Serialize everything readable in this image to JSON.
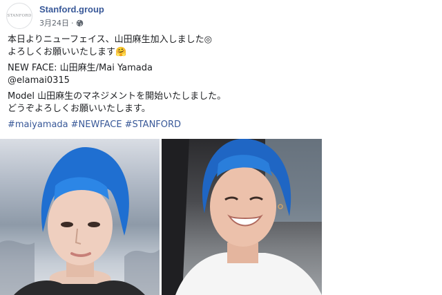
{
  "post": {
    "author": {
      "avatar_text": "STANFORD",
      "name": "Stanford.group"
    },
    "date": "3月24日",
    "separator": "·",
    "privacy_icon": "globe-icon",
    "paragraphs": [
      [
        "本日よりニューフェイス、山田麻生加入しました◎",
        "よろしくお願いいたします🤗"
      ],
      [
        "NEW FACE: 山田麻生/Mai Yamada",
        "@elamai0315"
      ],
      [
        "Model 山田麻生のマネジメントを開始いたしました。",
        "どうぞよろしくお願いいたします。"
      ]
    ],
    "hashtags": [
      "#maiyamada",
      "#NEWFACE",
      "#STANFORD"
    ]
  },
  "colors": {
    "link": "#385898",
    "meta": "#606770",
    "text": "#1c1e21"
  }
}
